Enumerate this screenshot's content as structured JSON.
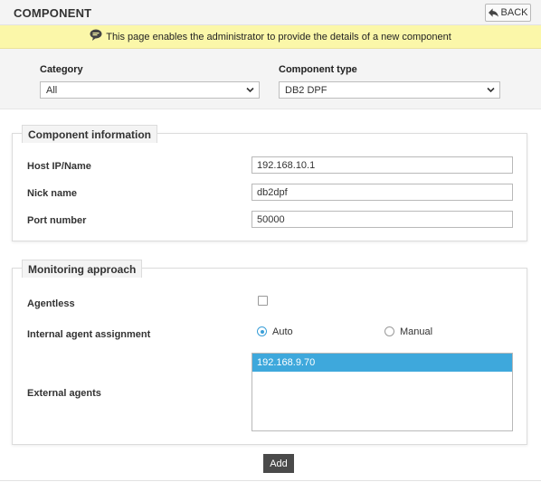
{
  "header": {
    "title": "COMPONENT",
    "back_label": "BACK"
  },
  "notice": {
    "text": "This page enables the administrator to provide the details of a new component"
  },
  "selectors": {
    "category_label": "Category",
    "category_value": "All",
    "component_type_label": "Component type",
    "component_type_value": "DB2 DPF"
  },
  "component_info": {
    "legend": "Component information",
    "host_label": "Host IP/Name",
    "host_value": "192.168.10.1",
    "nick_label": "Nick name",
    "nick_value": "db2dpf",
    "port_label": "Port number",
    "port_value": "50000"
  },
  "monitoring": {
    "legend": "Monitoring approach",
    "agentless_label": "Agentless",
    "agentless_checked": false,
    "internal_label": "Internal agent assignment",
    "option_auto": "Auto",
    "option_manual": "Manual",
    "selected_option": "Auto",
    "external_label": "External agents",
    "external_agents": [
      "192.168.9.70"
    ]
  },
  "actions": {
    "add_label": "Add"
  },
  "colors": {
    "notice_bg": "#fbf7a9",
    "accent": "#3ea8dc",
    "add_button_bg": "#4a4a4a"
  }
}
